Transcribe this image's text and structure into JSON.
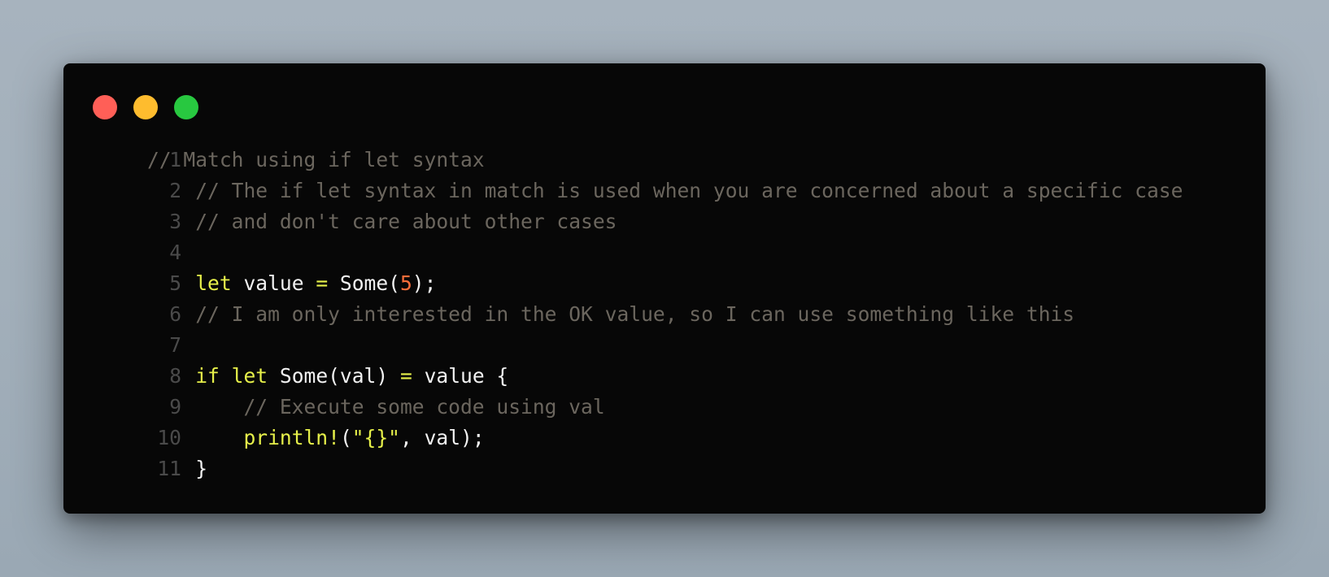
{
  "window": {
    "buttons": {
      "close": "close",
      "minimize": "minimize",
      "maximize": "maximize"
    },
    "colors": {
      "close": "#ff5f57",
      "minimize": "#febc2e",
      "maximize": "#28c840",
      "background": "#070707",
      "comment": "#6b665e",
      "keyword": "#e6f04a",
      "number": "#ff6e3a",
      "text": "#f2f2f2"
    }
  },
  "code": {
    "line_numbers": [
      "1",
      "2",
      "3",
      "4",
      "5",
      "6",
      "7",
      "8",
      "9",
      "10",
      "11"
    ],
    "lines": [
      [
        {
          "t": "comment",
          "v": "// Match using if let syntax"
        }
      ],
      [
        {
          "t": "comment",
          "v": "    // The if let syntax in match is used when you are concerned about a specific case"
        }
      ],
      [
        {
          "t": "comment",
          "v": "    // and don't care about other cases"
        }
      ],
      [],
      [
        {
          "t": "plain",
          "v": "    "
        },
        {
          "t": "kw",
          "v": "let"
        },
        {
          "t": "plain",
          "v": " value "
        },
        {
          "t": "op",
          "v": "="
        },
        {
          "t": "plain",
          "v": " Some("
        },
        {
          "t": "num",
          "v": "5"
        },
        {
          "t": "plain",
          "v": ");"
        }
      ],
      [
        {
          "t": "comment",
          "v": "    // I am only interested in the OK value, so I can use something like this"
        }
      ],
      [],
      [
        {
          "t": "plain",
          "v": "    "
        },
        {
          "t": "kw",
          "v": "if"
        },
        {
          "t": "plain",
          "v": " "
        },
        {
          "t": "kw",
          "v": "let"
        },
        {
          "t": "plain",
          "v": " Some(val) "
        },
        {
          "t": "op",
          "v": "="
        },
        {
          "t": "plain",
          "v": " value {"
        }
      ],
      [
        {
          "t": "comment",
          "v": "        // Execute some code using val"
        }
      ],
      [
        {
          "t": "plain",
          "v": "        "
        },
        {
          "t": "kw",
          "v": "println!"
        },
        {
          "t": "plain",
          "v": "("
        },
        {
          "t": "str",
          "v": "\"{}\""
        },
        {
          "t": "plain",
          "v": ", val);"
        }
      ],
      [
        {
          "t": "plain",
          "v": "    }"
        }
      ]
    ]
  }
}
